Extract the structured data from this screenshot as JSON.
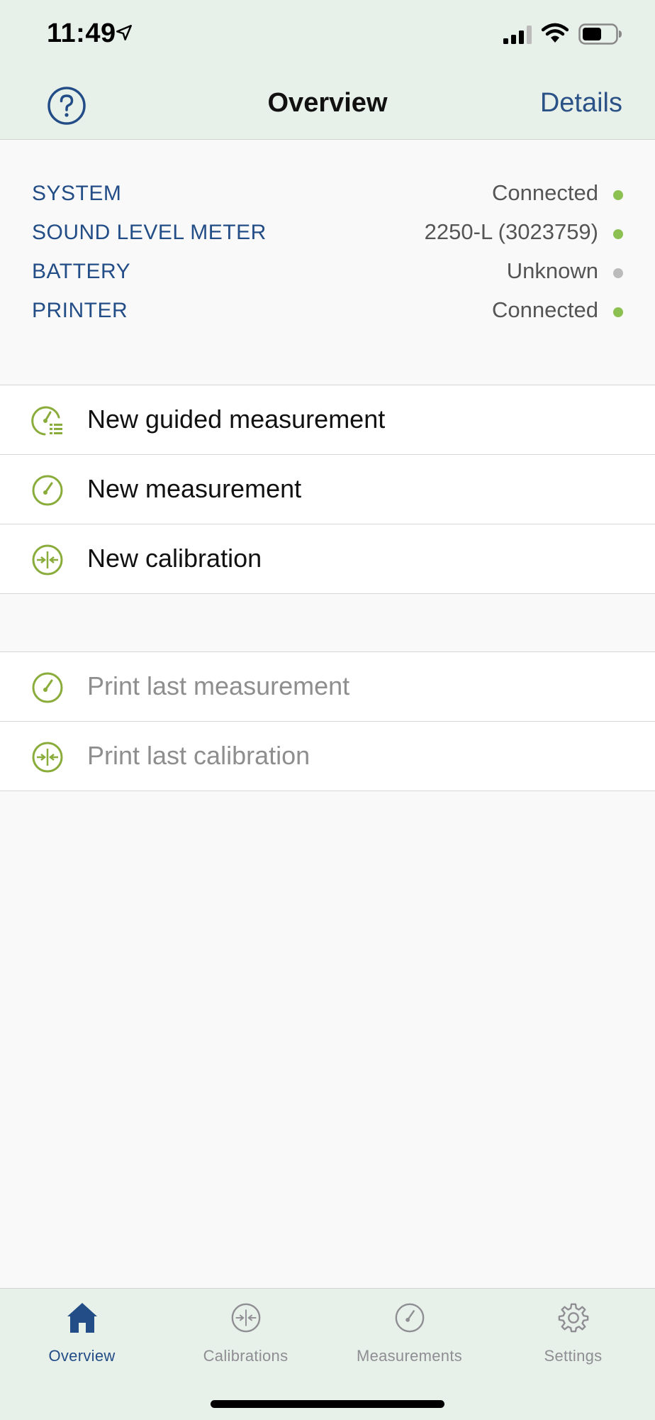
{
  "status_bar": {
    "time": "11:49"
  },
  "nav": {
    "title": "Overview",
    "details_label": "Details"
  },
  "status_items": [
    {
      "label": "SYSTEM",
      "value": "Connected",
      "dot_color": "#8cc152"
    },
    {
      "label": "SOUND LEVEL METER",
      "value": "2250-L (3023759)",
      "dot_color": "#8cc152"
    },
    {
      "label": "BATTERY",
      "value": "Unknown",
      "dot_color": "#bbbbbb"
    },
    {
      "label": "PRINTER",
      "value": "Connected",
      "dot_color": "#8cc152"
    }
  ],
  "actions": [
    {
      "label": "New guided measurement",
      "icon": "guided-measurement-icon"
    },
    {
      "label": "New measurement",
      "icon": "gauge-icon"
    },
    {
      "label": "New calibration",
      "icon": "calibration-icon"
    }
  ],
  "print_actions": [
    {
      "label": "Print last measurement",
      "icon": "gauge-icon"
    },
    {
      "label": "Print last calibration",
      "icon": "calibration-icon"
    }
  ],
  "tabs": [
    {
      "label": "Overview",
      "icon": "home-icon",
      "active": true
    },
    {
      "label": "Calibrations",
      "icon": "calibration-icon",
      "active": false
    },
    {
      "label": "Measurements",
      "icon": "gauge-icon",
      "active": false
    },
    {
      "label": "Settings",
      "icon": "gear-icon",
      "active": false
    }
  ],
  "colors": {
    "accent_blue": "#234d86",
    "icon_green": "#8aac3a",
    "header_bg": "#e8f0ea"
  }
}
